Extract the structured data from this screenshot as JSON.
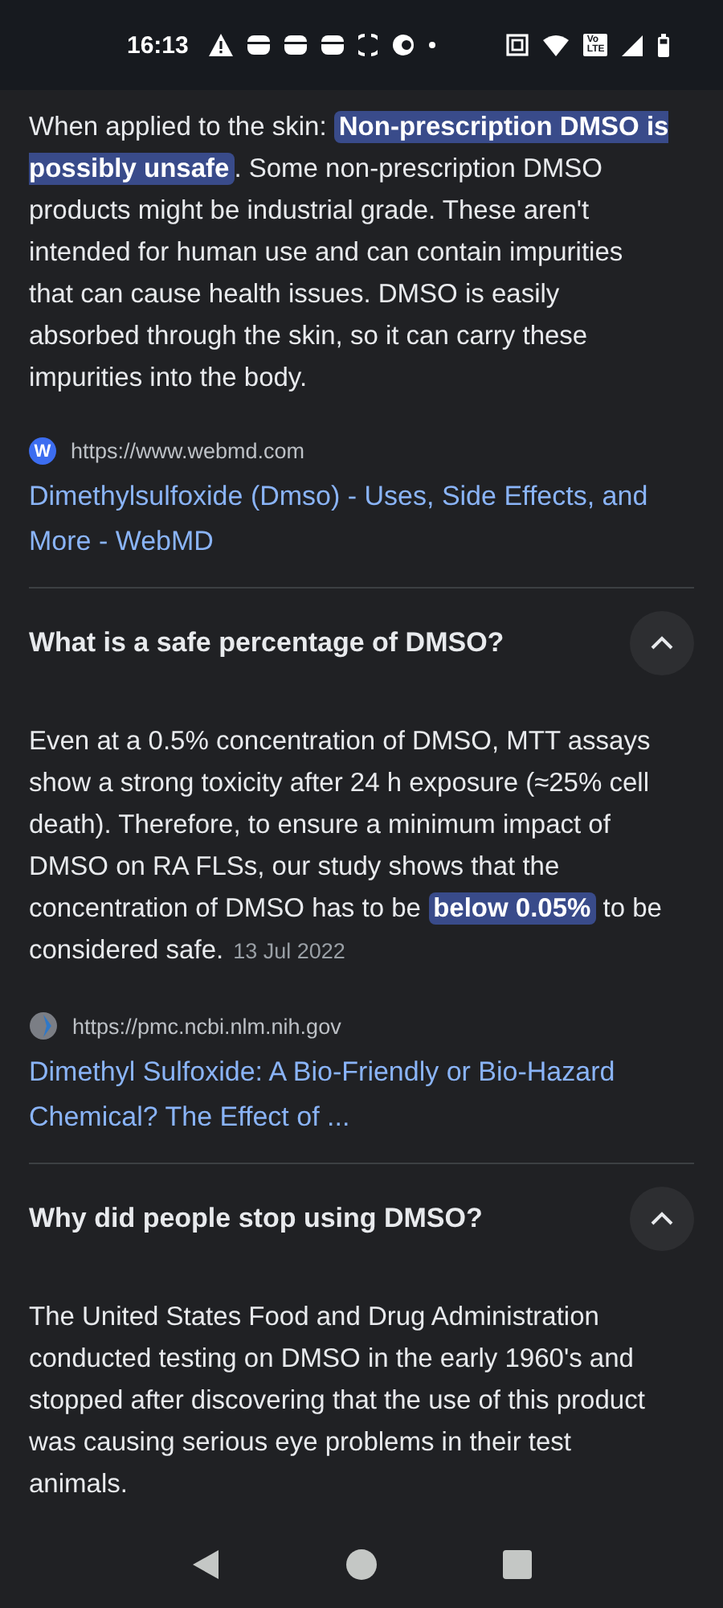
{
  "status_bar": {
    "time": "16:13",
    "volte_badge": [
      "Vo",
      "LTE"
    ]
  },
  "intro": {
    "answer": [
      {
        "text": "When applied to the skin: ",
        "highlighted": false
      },
      {
        "text": "Non-prescription DMSO is possibly unsafe",
        "highlighted": true
      },
      {
        "text": ". Some non-prescription DMSO products might be industrial grade. These aren't intended for human use and can contain impurities that can cause health issues. DMSO is easily absorbed through the skin, so it can carry these impurities into the body.",
        "highlighted": false
      }
    ],
    "source": {
      "favicon": "W",
      "url": "https://www.webmd.com",
      "title": "Dimethylsulfoxide (Dmso) - Uses, Side Effects, and More - WebMD"
    }
  },
  "questions": [
    {
      "question": "What is a safe percentage of DMSO?",
      "expanded": true,
      "answer": [
        {
          "text": "Even at a 0.5% concentration of DMSO, MTT assays show a strong toxicity after 24 h exposure (≈25% cell death). Therefore, to ensure a minimum impact of DMSO on RA FLSs, our study shows that the concentration of DMSO has to be ",
          "highlighted": false
        },
        {
          "text": "below 0.05%",
          "highlighted": true
        },
        {
          "text": " to be considered safe.",
          "highlighted": false
        }
      ],
      "date": "13 Jul 2022",
      "source": {
        "url": "https://pmc.ncbi.nlm.nih.gov",
        "title": "Dimethyl Sulfoxide: A Bio-Friendly or Bio-Hazard Chemical? The Effect of ..."
      }
    },
    {
      "question": "Why did people stop using DMSO?",
      "expanded": true,
      "answer": [
        {
          "text": "The United States Food and Drug Administration conducted testing on DMSO in the early 1960's and stopped after discovering that the use of this product was causing serious eye problems in their test animals.",
          "highlighted": false
        }
      ]
    }
  ]
}
